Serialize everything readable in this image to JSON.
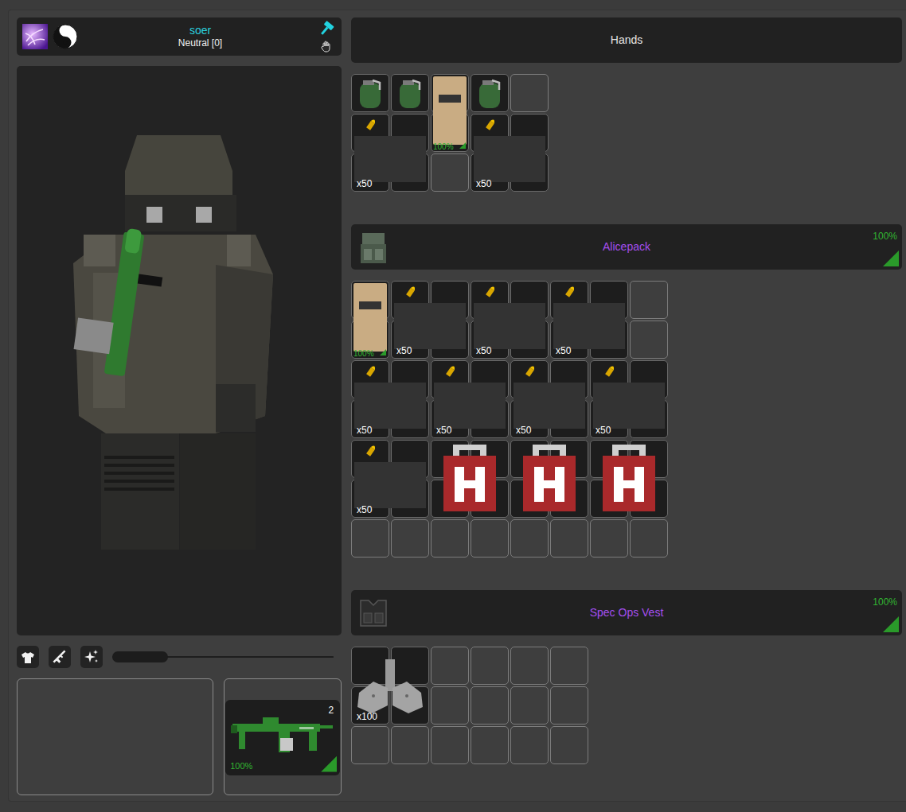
{
  "player": {
    "name": "soer",
    "reputation": "Neutral [0]"
  },
  "preview": {
    "zoom_level": 0.25
  },
  "slots": [
    {
      "kind": "secondary",
      "item": null
    },
    {
      "kind": "primary",
      "item": {
        "kind": "rifle",
        "count": "2",
        "quality": "100%",
        "quality_level": 1
      }
    }
  ],
  "containers": [
    {
      "title": "Hands",
      "kind": "hands",
      "width": 5,
      "height": 3,
      "items": [
        {
          "kind": "grenade",
          "x": 0,
          "y": 0
        },
        {
          "kind": "grenade",
          "x": 1,
          "y": 0
        },
        {
          "kind": "plate",
          "x": 2,
          "y": 0,
          "quality": "100%",
          "quality_level": 1
        },
        {
          "kind": "grenade",
          "x": 3,
          "y": 0
        },
        {
          "kind": "ammo",
          "x": 0,
          "y": 1,
          "amount": "x50"
        },
        {
          "kind": "ammo",
          "x": 3,
          "y": 1,
          "amount": "x50"
        }
      ]
    },
    {
      "title": "Alicepack",
      "kind": "backpack",
      "quality": "100%",
      "quality_level": 1,
      "width": 8,
      "height": 7,
      "items": [
        {
          "kind": "plate",
          "x": 0,
          "y": 0,
          "quality": "100%",
          "quality_level": 1
        },
        {
          "kind": "ammo",
          "x": 1,
          "y": 0,
          "amount": "x50"
        },
        {
          "kind": "ammo",
          "x": 3,
          "y": 0,
          "amount": "x50"
        },
        {
          "kind": "ammo",
          "x": 5,
          "y": 0,
          "amount": "x50"
        },
        {
          "kind": "ammo",
          "x": 0,
          "y": 2,
          "amount": "x50"
        },
        {
          "kind": "ammo",
          "x": 2,
          "y": 2,
          "amount": "x50"
        },
        {
          "kind": "ammo",
          "x": 4,
          "y": 2,
          "amount": "x50"
        },
        {
          "kind": "ammo",
          "x": 6,
          "y": 2,
          "amount": "x50"
        },
        {
          "kind": "ammo",
          "x": 0,
          "y": 4,
          "amount": "x50"
        },
        {
          "kind": "medkit",
          "x": 2,
          "y": 4
        },
        {
          "kind": "medkit",
          "x": 4,
          "y": 4
        },
        {
          "kind": "medkit",
          "x": 6,
          "y": 4
        }
      ]
    },
    {
      "title": "Spec Ops Vest",
      "kind": "vest",
      "quality": "100%",
      "quality_level": 1,
      "width": 6,
      "height": 3,
      "items": [
        {
          "kind": "bullets",
          "x": 0,
          "y": 0,
          "amount": "x100"
        }
      ]
    }
  ]
}
